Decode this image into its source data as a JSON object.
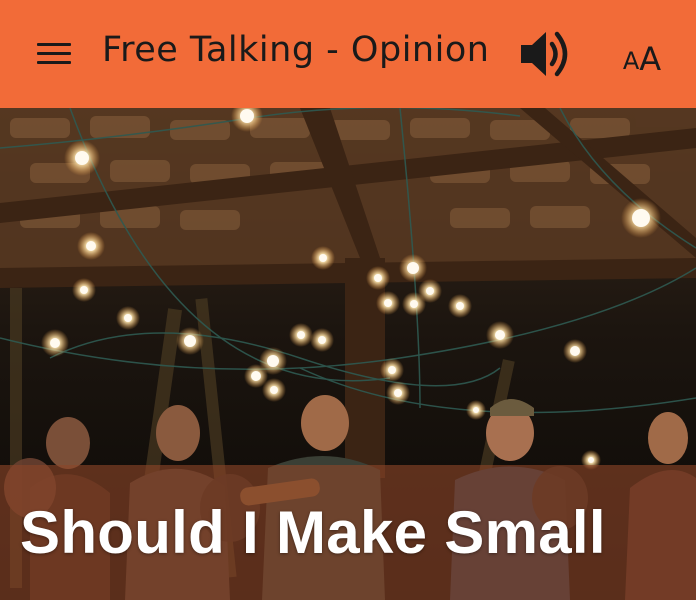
{
  "header": {
    "title": "Free Talking - Opinion",
    "menu_icon": "hamburger-menu-icon",
    "audio_icon": "speaker-icon",
    "font_size_small": "A",
    "font_size_big": "A",
    "background_color": "#f26b38"
  },
  "hero": {
    "image_description_icon": "photo",
    "article_title": "Should I Make Small"
  }
}
